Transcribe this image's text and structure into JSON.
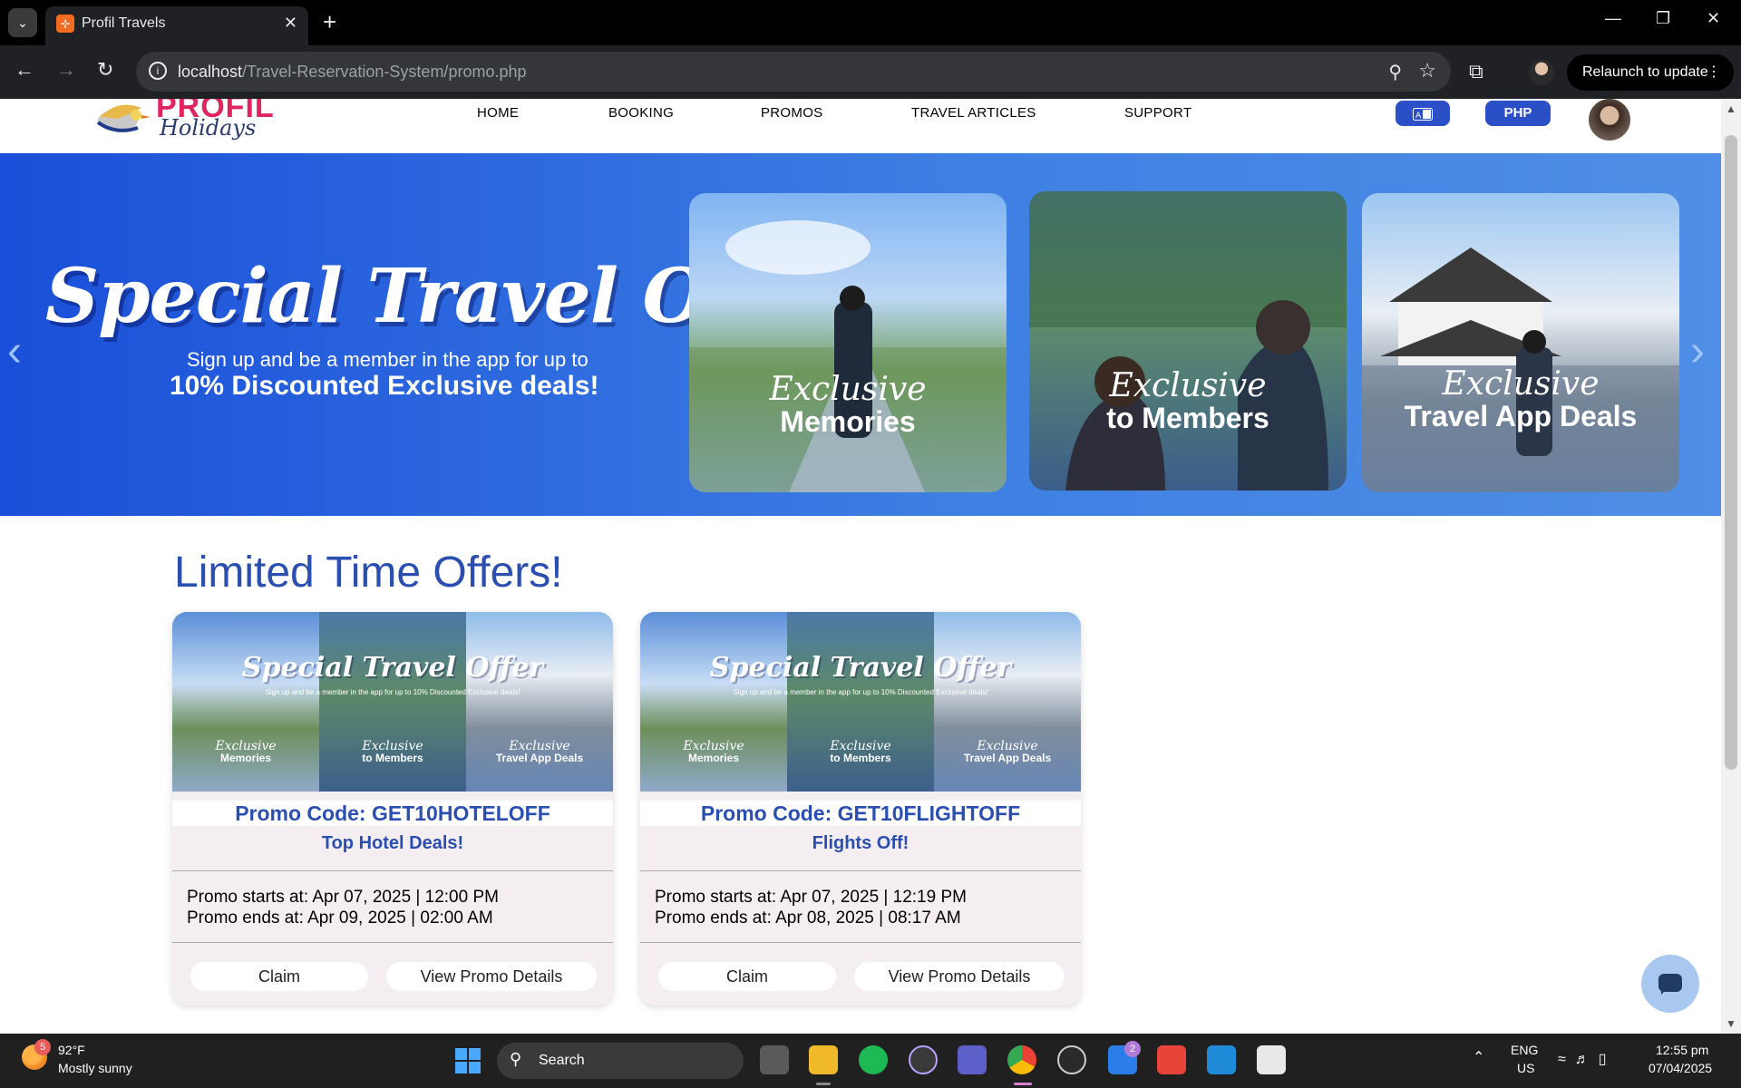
{
  "browser": {
    "tab_title": "Profil Travels",
    "url_host": "localhost",
    "url_path": "/Travel-Reservation-System/promo.php",
    "relaunch_label": "Relaunch to update"
  },
  "site": {
    "brand": "PROFIL",
    "brand_sub": "Holidays",
    "nav": [
      "HOME",
      "BOOKING",
      "PROMOS",
      "TRAVEL ARTICLES",
      "SUPPORT"
    ],
    "currency": "PHP"
  },
  "hero": {
    "title": "Special Travel Offer",
    "subtitle_line1": "Sign up and be a member in the app for up to",
    "subtitle_line2": "10% Discounted Exclusive deals!",
    "cards": [
      {
        "script": "Exclusive",
        "bold": "Memories"
      },
      {
        "script": "Exclusive",
        "bold": "to Members"
      },
      {
        "script": "Exclusive",
        "bold": "Travel App Deals"
      }
    ]
  },
  "offers": {
    "section_title": "Limited Time Offers!",
    "image_title": "Special Travel Offer",
    "image_sub": "Sign up and be a member in the app for up to 10% Discounted Exclusive deals!",
    "image_labels": [
      {
        "script": "Exclusive",
        "bold": "Memories"
      },
      {
        "script": "Exclusive",
        "bold": "to Members"
      },
      {
        "script": "Exclusive",
        "bold": "Travel App Deals"
      }
    ],
    "promos": [
      {
        "code": "Promo Code: GET10HOTELOFF",
        "name": "Top Hotel Deals!",
        "starts": "Promo starts at: Apr 07, 2025 | 12:00 PM",
        "ends": "Promo ends at: Apr 09, 2025 | 02:00 AM",
        "claim": "Claim",
        "details": "View Promo Details"
      },
      {
        "code": "Promo Code: GET10FLIGHTOFF",
        "name": "Flights Off!",
        "starts": "Promo starts at: Apr 07, 2025 | 12:19 PM",
        "ends": "Promo ends at: Apr 08, 2025 | 08:17 AM",
        "claim": "Claim",
        "details": "View Promo Details"
      }
    ]
  },
  "taskbar": {
    "weather_badge": "5",
    "weather_temp": "92°F",
    "weather_desc": "Mostly sunny",
    "search_label": "Search",
    "teams_badge": "2",
    "lang_line1": "ENG",
    "lang_line2": "US",
    "time": "12:55 pm",
    "date": "07/04/2025"
  }
}
